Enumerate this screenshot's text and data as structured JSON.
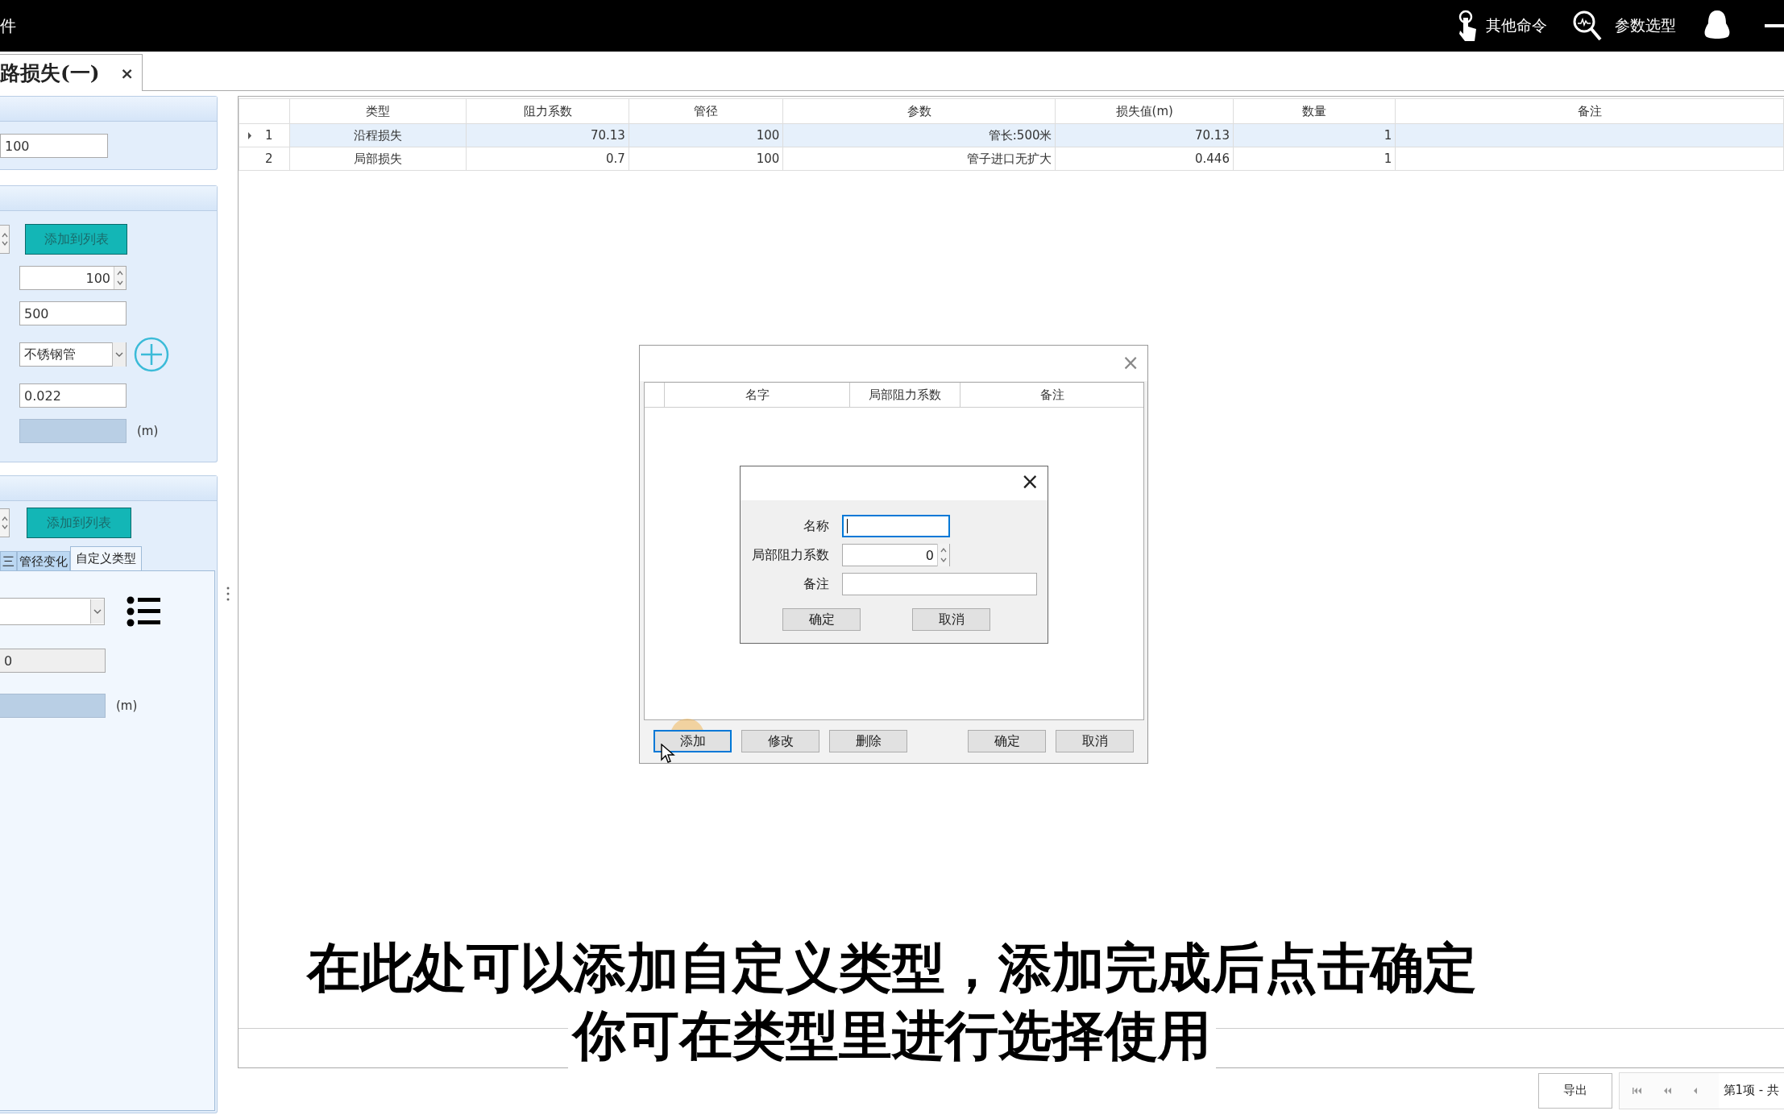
{
  "top_bar": {
    "title_fragment": "件",
    "commands": [
      {
        "label": "其他命令",
        "kind": "hand"
      },
      {
        "label": "参数选型",
        "kind": "search"
      }
    ]
  },
  "document_tab": {
    "title": "路损失(一)",
    "close": "×"
  },
  "left_panel": {
    "section_1": {
      "value": "100"
    },
    "section_2": {
      "add_button": "添加到列表",
      "diameter": "100",
      "length": "500",
      "material": "不锈钢管",
      "roughness": "0.022",
      "unit": "(m)"
    },
    "section_3": {
      "add_button": "添加到列表",
      "tabs": [
        {
          "label": "三",
          "selected": false
        },
        {
          "label": "管径变化",
          "selected": false
        },
        {
          "label": "自定义类型",
          "selected": true
        }
      ],
      "coefficient": "0",
      "unit": "(m)"
    }
  },
  "table": {
    "columns": [
      "类型",
      "阻力系数",
      "管径",
      "参数",
      "损失值(m)",
      "数量",
      "备注"
    ],
    "rows": [
      {
        "number": "1",
        "selected": true,
        "cells": [
          "沿程损失",
          "70.13",
          "100",
          "管长:500米",
          "70.13",
          "1"
        ]
      },
      {
        "number": "2",
        "selected": false,
        "cells": [
          "局部损失",
          "0.7",
          "100",
          "管子进口无扩大",
          "0.446",
          "1"
        ]
      }
    ]
  },
  "pager": {
    "export_button": "导出",
    "page_text": "第1项 - 共"
  },
  "dialog": {
    "close": "×",
    "columns": [
      "名字",
      "局部阻力系数",
      "备注"
    ],
    "buttons": [
      {
        "label": "添加",
        "focused": true
      },
      {
        "label": "修改",
        "focused": false
      },
      {
        "label": "删除",
        "focused": false
      },
      {
        "label": "确定",
        "focused": false
      },
      {
        "label": "取消",
        "focused": false
      }
    ],
    "inner_dialog": {
      "close": "×",
      "fields": [
        {
          "label": "名称",
          "kind": "text",
          "focused": true
        },
        {
          "label": "局部阻力系数",
          "kind": "spinner",
          "value": "0",
          "focused": false
        },
        {
          "label": "备注",
          "kind": "text",
          "focused": false
        }
      ],
      "buttons": [
        "确定",
        "取消"
      ]
    }
  },
  "subtitle": [
    "在此处可以添加自定义类型，添加完成后点击确定",
    "你可在类型里进行选择使用"
  ]
}
